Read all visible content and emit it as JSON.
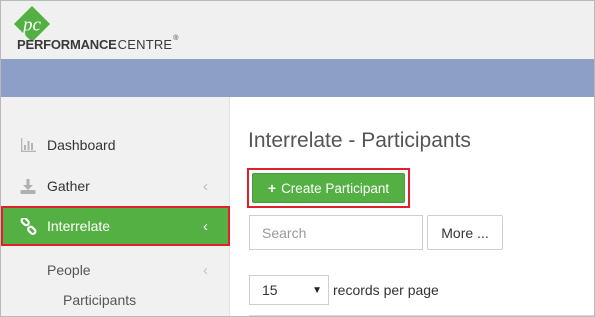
{
  "app": {
    "logo_mark_text": "pc",
    "logo_text_bold": "PERFORMANCE",
    "logo_text_regular": "CENTRE",
    "logo_registered": "®",
    "brand_green": "#55b043",
    "band_color": "#8d9fc7",
    "highlight_color": "#e0202a"
  },
  "sidebar": {
    "items": [
      {
        "label": "Dashboard",
        "icon": "bar-chart-icon",
        "active": false,
        "chevron": ""
      },
      {
        "label": "Gather",
        "icon": "download-icon",
        "active": false,
        "chevron": "‹"
      },
      {
        "label": "Interrelate",
        "icon": "link-icon",
        "active": true,
        "chevron": "‹"
      }
    ],
    "subitems": [
      {
        "label": "People",
        "chevron": "‹"
      },
      {
        "label": "Participants",
        "chevron": ""
      }
    ]
  },
  "main": {
    "title": "Interrelate - Participants",
    "create_button": {
      "icon": "+",
      "label": "Create Participant"
    },
    "search": {
      "placeholder": "Search",
      "value": ""
    },
    "more_button": "More ...",
    "page_size": {
      "selected": "15",
      "caret": "▼"
    },
    "records_label": "records per page"
  }
}
